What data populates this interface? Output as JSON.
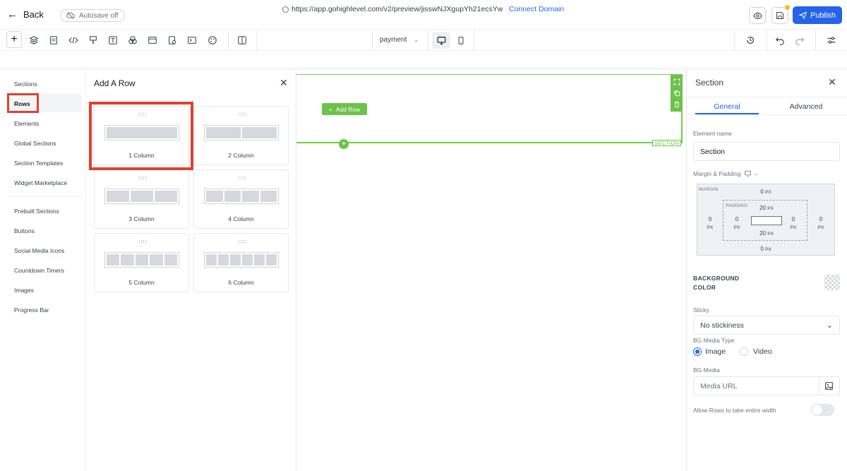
{
  "header": {
    "back_label": "Back",
    "autosave_label": "Autosave off",
    "publish_label": "Publish"
  },
  "toolbar": {
    "page_select_value": "payment",
    "tool_icons": [
      "add-icon",
      "layers-icon",
      "page-icon",
      "code-icon",
      "paint-icon",
      "text-icon",
      "color-blend-icon",
      "layout-icon",
      "form-icon",
      "terminal-icon",
      "palette-icon",
      "columns-icon"
    ]
  },
  "urlbar": {
    "url": "https://app.gohighlevel.com/v2/preview/jisswNJXgupYh21ecsYw",
    "connect_label": "Connect Domain"
  },
  "leftnav": {
    "items_top": [
      "Sections",
      "Rows",
      "Elements",
      "Global Sections",
      "Section Templates",
      "Widget Marketplace"
    ],
    "items_bottom": [
      "Prebuilt Sections",
      "Buttons",
      "Social Media Icons",
      "Countdown Timers",
      "Images",
      "Progress Bar"
    ],
    "active": "Rows"
  },
  "rowpanel": {
    "title": "Add A Row",
    "cards": [
      "1 Column",
      "2 Column",
      "3 Column",
      "4 Column",
      "5 Column",
      "6 Column"
    ]
  },
  "canvas": {
    "add_row_label": "Add Row",
    "section_tag": "SECTION"
  },
  "props": {
    "title": "Section",
    "tab_general": "General",
    "tab_advanced": "Advanced",
    "element_name_label": "Element name",
    "element_name_value": "Section",
    "margin_padding_label": "Margin & Padding",
    "margin_cap": "MARGIN",
    "padding_cap": "PADDING",
    "margin_top": "0",
    "margin_bottom": "0",
    "margin_left": "0",
    "margin_right": "0",
    "padding_top": "20",
    "padding_bottom": "20",
    "padding_left": "0",
    "padding_right": "0",
    "unit": "PX",
    "bg_color_label_1": "BACKGROUND",
    "bg_color_label_2": "COLOR",
    "sticky_label": "Sticky",
    "sticky_value": "No stickiness",
    "bg_media_type_label": "BG Media Type",
    "media_type_image": "Image",
    "media_type_video": "Video",
    "bg_media_label": "BG Media",
    "media_url_placeholder": "Media URL",
    "full_width_label": "Allow Rows to take entire width"
  },
  "colors": {
    "accent": "#2563eb",
    "highlight": "#e0412f",
    "section_green": "#6cc24a"
  }
}
